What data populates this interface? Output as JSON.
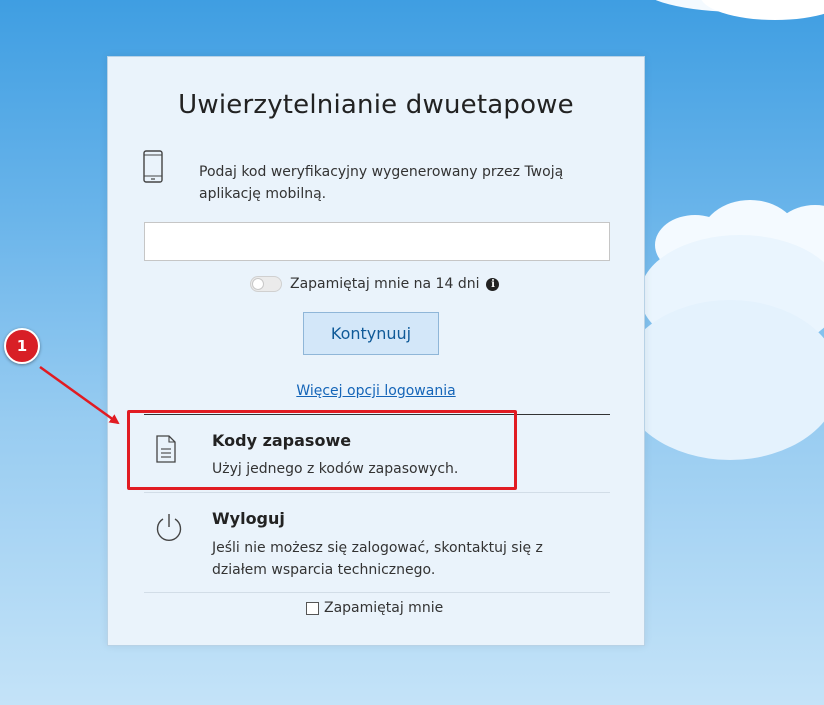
{
  "colors": {
    "accent": "#1565b8",
    "button_bg": "#d3e7f9",
    "button_text": "#0f5a98",
    "annotation": "#e11b22"
  },
  "auth": {
    "title": "Uwierzytelnianie dwuetapowe",
    "instruction": "Podaj kod weryfikacyjny wygenerowany przez Twoją aplikację mobilną.",
    "instruction_icon": "mobile-phone-icon",
    "code_input": {
      "value": "",
      "placeholder": ""
    },
    "remember_toggle": {
      "label": "Zapamiętaj mnie na 14 dni",
      "on": false,
      "info_icon": "info-icon"
    },
    "continue_label": "Kontynuuj",
    "more_options_link": "Więcej opcji logowania",
    "options": [
      {
        "icon": "document-icon",
        "title": "Kody zapasowe",
        "desc": "Użyj jednego z kodów zapasowych."
      },
      {
        "icon": "power-icon",
        "title": "Wyloguj",
        "desc": "Jeśli nie możesz się zalogować, skontaktuj się z działem wsparcia technicznego."
      }
    ],
    "remember_me": {
      "label": "Zapamiętaj mnie",
      "checked": false
    }
  },
  "annotation": {
    "badge_number": "1"
  }
}
